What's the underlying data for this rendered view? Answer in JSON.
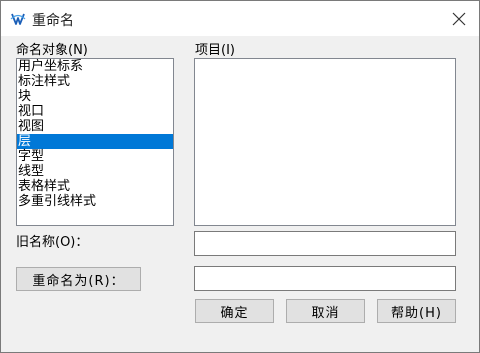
{
  "window": {
    "title": "重命名"
  },
  "left_panel": {
    "label": "命名对象(N)",
    "items": [
      {
        "label": "用户坐标系",
        "selected": false
      },
      {
        "label": "标注样式",
        "selected": false
      },
      {
        "label": "块",
        "selected": false
      },
      {
        "label": "视口",
        "selected": false
      },
      {
        "label": "视图",
        "selected": false
      },
      {
        "label": "层",
        "selected": true
      },
      {
        "label": "字型",
        "selected": false
      },
      {
        "label": "线型",
        "selected": false
      },
      {
        "label": "表格样式",
        "selected": false
      },
      {
        "label": "多重引线样式",
        "selected": false
      }
    ]
  },
  "right_panel": {
    "label": "项目(I)"
  },
  "old_name": {
    "label": "旧名称(O)：",
    "value": ""
  },
  "new_name": {
    "button_label": "重命名为(R)：",
    "value": ""
  },
  "buttons": {
    "ok": "确定",
    "cancel": "取消",
    "help": "帮助(H)"
  },
  "colors": {
    "selection": "#0078d7"
  },
  "icons": {
    "app": "cad-app-icon",
    "close": "close-icon"
  }
}
